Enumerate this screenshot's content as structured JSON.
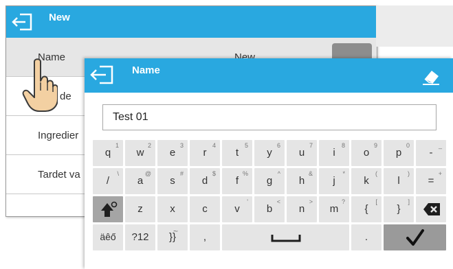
{
  "background_window": {
    "title": "New",
    "rows": [
      {
        "label": "Name",
        "value": "New"
      },
      {
        "label": "de",
        "value": ""
      },
      {
        "label": "Ingredier",
        "value": ""
      },
      {
        "label": "Tardet va",
        "value": ""
      }
    ]
  },
  "keyboard_dialog": {
    "title": "Name",
    "input_value": "Test 01"
  },
  "keyboard": {
    "row1": [
      {
        "main": "q",
        "alt": "1"
      },
      {
        "main": "w",
        "alt": "2"
      },
      {
        "main": "e",
        "alt": "3"
      },
      {
        "main": "r",
        "alt": "4"
      },
      {
        "main": "t",
        "alt": "5"
      },
      {
        "main": "y",
        "alt": "6"
      },
      {
        "main": "u",
        "alt": "7"
      },
      {
        "main": "i",
        "alt": "8"
      },
      {
        "main": "o",
        "alt": "9"
      },
      {
        "main": "p",
        "alt": "0"
      },
      {
        "main": "-",
        "alt": "_"
      }
    ],
    "row2": [
      {
        "main": "/",
        "alt": "\\"
      },
      {
        "main": "a",
        "alt": "@"
      },
      {
        "main": "s",
        "alt": "#"
      },
      {
        "main": "d",
        "alt": "$"
      },
      {
        "main": "f",
        "alt": "%"
      },
      {
        "main": "g",
        "alt": "^"
      },
      {
        "main": "h",
        "alt": "&"
      },
      {
        "main": "j",
        "alt": "*"
      },
      {
        "main": "k",
        "alt": "("
      },
      {
        "main": "l",
        "alt": ")"
      },
      {
        "main": "=",
        "alt": "+"
      }
    ],
    "row3": [
      {
        "main": "z",
        "alt": ""
      },
      {
        "main": "x",
        "alt": ""
      },
      {
        "main": "c",
        "alt": ""
      },
      {
        "main": "v",
        "alt": "'"
      },
      {
        "main": "b",
        "alt": "<"
      },
      {
        "main": "n",
        "alt": ">"
      },
      {
        "main": "m",
        "alt": "?"
      },
      {
        "main": "{",
        "alt": "["
      },
      {
        "main": "}",
        "alt": "]"
      }
    ],
    "row4": {
      "lang_label": "äêő",
      "numeric_label": "?12",
      "braces_label": "}}",
      "braces_alt": "~",
      "comma_label": ",",
      "period_label": "."
    }
  },
  "icons": {
    "back": "back-arrow-icon",
    "erase": "eraser-icon",
    "shift": "shift-icon",
    "backspace": "backspace-icon",
    "space": "space-icon",
    "ok": "checkmark-icon",
    "hand": "hand-pointer-icon"
  },
  "colors": {
    "titlebar": "#29a8e0",
    "key": "#e5e5e5",
    "key_dark": "#a5a5a5"
  }
}
